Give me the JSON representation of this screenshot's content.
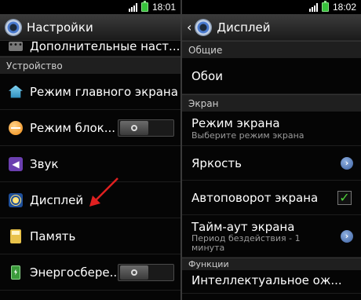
{
  "left": {
    "status_time": "18:01",
    "title": "Настройки",
    "section_device": "Устройство",
    "rows": [
      {
        "label": "Дополнительные наст...",
        "icon": "more-dots-icon"
      },
      {
        "label": "Режим главного экрана",
        "icon": "home-screen-icon"
      },
      {
        "label": "Режим блок...",
        "icon": "lock-screen-icon",
        "toggle": "off"
      },
      {
        "label": "Звук",
        "icon": "sound-icon"
      },
      {
        "label": "Дисплей",
        "icon": "display-icon"
      },
      {
        "label": "Память",
        "icon": "storage-icon"
      },
      {
        "label": "Энергосбере...",
        "icon": "power-saving-icon",
        "toggle": "off"
      }
    ]
  },
  "right": {
    "status_time": "18:02",
    "title": "Дисплей",
    "section_general": "Общие",
    "wallpaper": "Обои",
    "section_screen": "Экран",
    "screen_mode": {
      "label": "Режим экрана",
      "sub": "Выберите режим экрана"
    },
    "brightness": "Яркость",
    "autorotate": {
      "label": "Автоповорот экрана",
      "checked": true
    },
    "timeout": {
      "label": "Тайм-аут экрана",
      "sub": "Период бездействия - 1 минута"
    },
    "section_functions": "Функции",
    "smart_stay": "Интеллектуальное ож..."
  },
  "colors": {
    "accent_check": "#4fd23a",
    "pointer_arrow": "#e02020"
  }
}
